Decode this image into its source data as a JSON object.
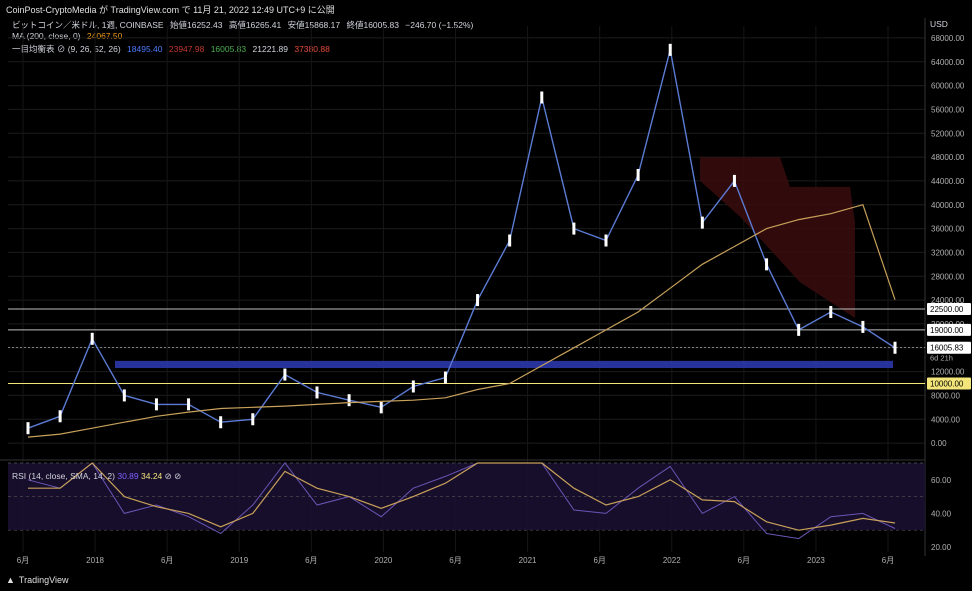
{
  "header": {
    "publisher_line": "CoinPost-CryptoMedia が TradingView.com で 11月 21, 2022 12:49 UTC+9 に公開"
  },
  "legend": {
    "symbol": "ビットコイン／米ドル, 1週, COINBASE",
    "open": "始値16252.43",
    "high": "高値16265.41",
    "low": "安値15868.17",
    "close": "終値16005.83",
    "change": "−246.70 (−1.52%)",
    "ma_label": "MA (200, close, 0)",
    "ma_value": "24067.50",
    "ichimoku_label": "一目均衡表 ⊘ (9, 26, 52, 26)",
    "ichimoku_values": [
      "18495.40",
      "23947.98",
      "16005.83",
      "21221.89",
      "37380.88"
    ],
    "rsi_label": "RSI (14, close, SMA, 14, 2)",
    "rsi_value": "30.89",
    "rsi_ma_value": "34.24",
    "rsi_extra": "⊘ ⊘"
  },
  "axis": {
    "currency": "USD",
    "footer": "TradingView"
  },
  "colors": {
    "background": "#000000",
    "candle_up": "#ffffff",
    "candle_down": "#ffffff",
    "price_line": "#5b7bd5",
    "ma200": "#c8a15a",
    "tenkan": "#3a5bd9",
    "kijun": "#a52a2a",
    "chikou": "#3d8c3d",
    "senkou_a": "#8fbc8f",
    "senkou_b": "#b03a2e",
    "support_band": "#2e3bb5",
    "hline": "#c0c0c0",
    "hline_yellow": "#f3e57a",
    "rsi": "#6a55b5",
    "rsi_ma": "#c8a15a"
  },
  "chart_data": {
    "type": "line",
    "title": "ビットコイン／米ドル, 1週, COINBASE",
    "x_tick_labels": [
      "6月",
      "2018",
      "6月",
      "2019",
      "6月",
      "2020",
      "6月",
      "2021",
      "6月",
      "2022",
      "6月",
      "2023",
      "6月"
    ],
    "x": [
      "2017-06",
      "2017-09",
      "2017-12",
      "2018-03",
      "2018-06",
      "2018-09",
      "2018-12",
      "2019-03",
      "2019-06",
      "2019-09",
      "2019-12",
      "2020-03",
      "2020-06",
      "2020-09",
      "2020-12",
      "2021-01",
      "2021-03",
      "2021-05",
      "2021-07",
      "2021-09",
      "2021-11",
      "2022-01",
      "2022-03",
      "2022-05",
      "2022-06",
      "2022-08",
      "2022-10",
      "2022-11"
    ],
    "y_tick_labels": [
      "68000.00",
      "64000.00",
      "60000.00",
      "56000.00",
      "52000.00",
      "48000.00",
      "44000.00",
      "40000.00",
      "36000.00",
      "32000.00",
      "28000.00",
      "24000.00",
      "20000.00",
      "16000.00",
      "12000.00",
      "8000.00",
      "4000.00",
      "0.00"
    ],
    "ylim": [
      -2000,
      70000
    ],
    "series": [
      {
        "name": "ビットコイン／米ドル",
        "values": [
          2500,
          4500,
          17500,
          8000,
          6500,
          6500,
          3500,
          4000,
          11500,
          8500,
          7200,
          6000,
          9500,
          11000,
          24000,
          34000,
          58000,
          36000,
          34000,
          45000,
          66000,
          37000,
          44000,
          30000,
          19000,
          22000,
          19500,
          16000
        ]
      },
      {
        "name": "MA",
        "values": [
          1000,
          1500,
          2500,
          3500,
          4500,
          5200,
          5800,
          6000,
          6200,
          6500,
          6800,
          7000,
          7200,
          7600,
          9000,
          10000,
          13000,
          16000,
          19000,
          22000,
          26000,
          30000,
          33000,
          36000,
          37500,
          38500,
          40000,
          24067.5
        ]
      }
    ],
    "horizontal_levels": {
      "labels": [
        "22500.00",
        "19000.00",
        "16005.83",
        "10000.00"
      ],
      "values": [
        22500,
        19000,
        16005.83,
        10000
      ]
    },
    "last_price_label": "16005.83",
    "countdown_label": "6d 21h",
    "support_band": [
      12600,
      13800
    ],
    "rsi_panel": {
      "y_tick_labels": [
        "60.00",
        "40.00",
        "20.00"
      ],
      "ylim": [
        17,
        70
      ],
      "values": [
        60,
        55,
        85,
        40,
        45,
        38,
        28,
        45,
        78,
        45,
        50,
        38,
        55,
        62,
        88,
        90,
        75,
        42,
        40,
        55,
        68,
        40,
        50,
        28,
        25,
        38,
        40,
        31
      ],
      "ma_values": [
        55,
        55,
        70,
        50,
        44,
        40,
        32,
        40,
        65,
        55,
        50,
        43,
        50,
        58,
        80,
        88,
        80,
        55,
        45,
        50,
        60,
        48,
        47,
        35,
        30,
        33,
        37,
        34.24
      ]
    }
  }
}
